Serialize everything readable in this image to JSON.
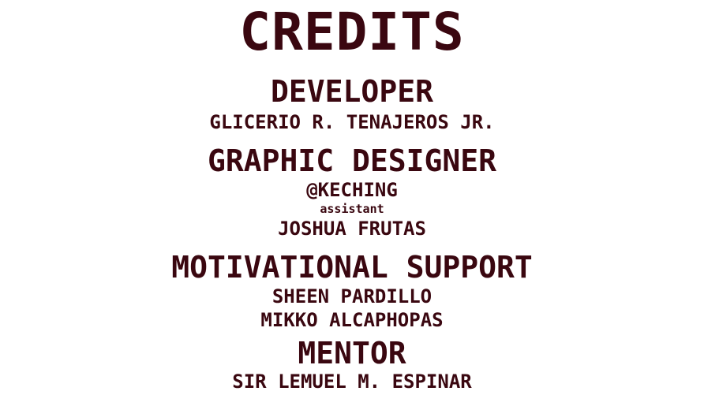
{
  "screen": {
    "title": "CREDITS"
  },
  "sections": [
    {
      "heading": "DEVELOPER",
      "names": [
        "GLICERIO R. TENAJEROS JR."
      ]
    },
    {
      "heading": "GRAPHIC DESIGNER",
      "names": [
        "@KECHING"
      ],
      "assistant_label": "assistant",
      "assistant_names": [
        "JOSHUA FRUTAS"
      ]
    },
    {
      "heading": "MOTIVATIONAL SUPPORT",
      "names": [
        "SHEEN PARDILLO",
        "MIKKO ALCAPHOPAS"
      ]
    },
    {
      "heading": "MENTOR",
      "names": [
        "SIR LEMUEL M. ESPINAR"
      ]
    }
  ],
  "colors": {
    "text": "#3a0710",
    "background": "#ffffff"
  }
}
